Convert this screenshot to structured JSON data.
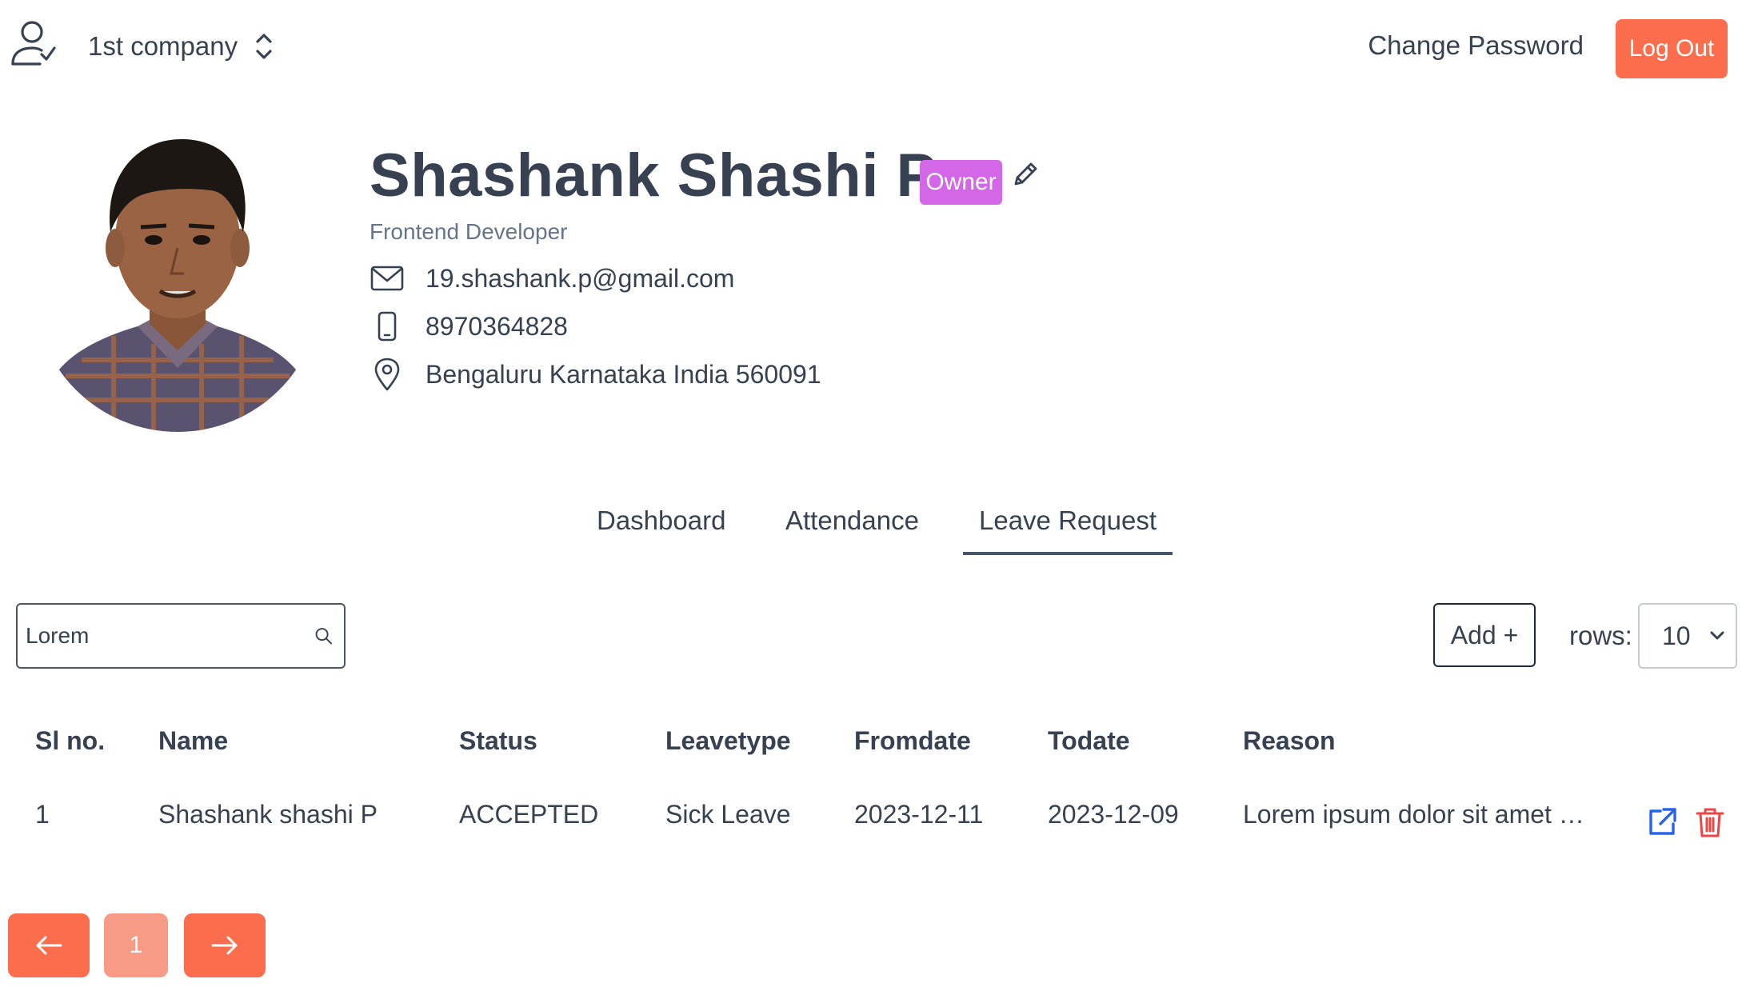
{
  "header": {
    "company": "1st company",
    "change_password": "Change Password",
    "logout": "Log Out"
  },
  "profile": {
    "name": "Shashank Shashi P",
    "role": "Owner",
    "job_title": "Frontend Developer",
    "email": "19.shashank.p@gmail.com",
    "phone": "8970364828",
    "address": "Bengaluru Karnataka India 560091"
  },
  "tabs": [
    {
      "label": "Dashboard",
      "active": false
    },
    {
      "label": "Attendance",
      "active": false
    },
    {
      "label": "Leave Request",
      "active": true
    }
  ],
  "controls": {
    "search_value": "Lorem",
    "add_label": "Add +",
    "rows_label": "rows:",
    "rows_value": "10"
  },
  "table": {
    "headers": [
      "Sl no.",
      "Name",
      "Status",
      "Leavetype",
      "Fromdate",
      "Todate",
      "Reason"
    ],
    "rows": [
      [
        "1",
        "Shashank shashi P",
        "ACCEPTED",
        "Sick Leave",
        "2023-12-11",
        "2023-12-09",
        "Lorem ipsum dolor sit amet …"
      ]
    ]
  },
  "pagination": {
    "current_page": "1"
  },
  "colors": {
    "accent": "#fb6d4c",
    "accent_light": "#f79b87",
    "badge": "#d466e8",
    "edit_icon": "#2563eb",
    "delete_icon": "#ef4444"
  }
}
